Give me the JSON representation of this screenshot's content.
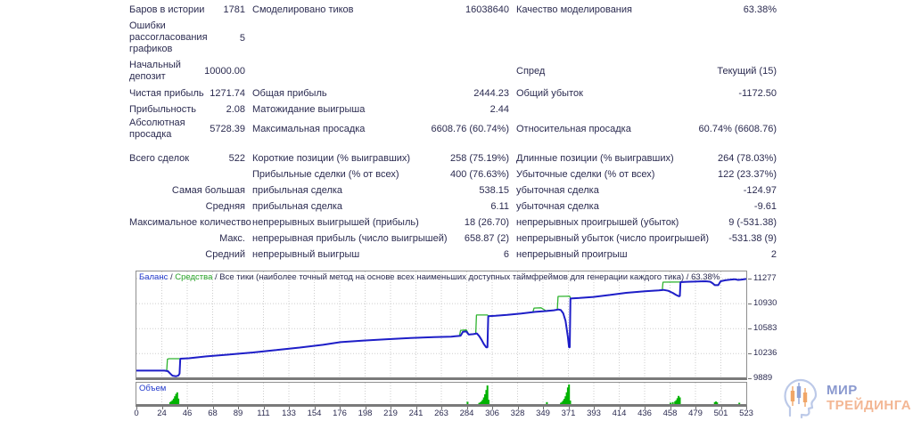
{
  "report": {
    "rows": [
      {
        "c1l": "Баров в истории",
        "c1v": "1781",
        "c2l": "Смоделировано тиков",
        "c2v": "16038640",
        "c3l": "Качество моделирования",
        "c3v": "63.38%"
      },
      {
        "c1l": "Ошибки рассогласования графиков",
        "c1v": "5",
        "c2l": "",
        "c2v": "",
        "c3l": "",
        "c3v": ""
      },
      {
        "c1l": "Начальный депозит",
        "c1v": "10000.00",
        "c2l": "",
        "c2v": "",
        "c3l": "Спред",
        "c3v": "Текущий (15)"
      },
      {
        "c1l": "Чистая прибыль",
        "c1v": "1271.74",
        "c2l": "Общая прибыль",
        "c2v": "2444.23",
        "c3l": "Общий убыток",
        "c3v": "-1172.50"
      },
      {
        "c1l": "Прибыльность",
        "c1v": "2.08",
        "c2l": "Матожидание выигрыша",
        "c2v": "2.44",
        "c3l": "",
        "c3v": ""
      },
      {
        "c1l": "Абсолютная просадка",
        "c1v": "5728.39",
        "c2l": "Максимальная просадка",
        "c2v": "6608.76 (60.74%)",
        "c3l": "Относительная просадка",
        "c3v": "60.74% (6608.76)"
      },
      {
        "c1l": "Всего сделок",
        "c1v": "522",
        "c2l": "Короткие позиции (% выигравших)",
        "c2v": "258 (75.19%)",
        "c3l": "Длинные позиции (% выигравших)",
        "c3v": "264 (78.03%)"
      },
      {
        "c1l": "",
        "c1v": "",
        "c2l": "Прибыльные сделки (% от всех)",
        "c2v": "400 (76.63%)",
        "c3l": "Убыточные сделки (% от всех)",
        "c3v": "122 (23.37%)"
      },
      {
        "c1l": "Самая большая",
        "c1v": "",
        "c2l": "прибыльная сделка",
        "c2v": "538.15",
        "c3l": "убыточная сделка",
        "c3v": "-124.97"
      },
      {
        "c1l": "Средняя",
        "c1v": "",
        "c2l": "прибыльная сделка",
        "c2v": "6.11",
        "c3l": "убыточная сделка",
        "c3v": "-9.61"
      },
      {
        "c1l": "Максимальное количество",
        "c1v": "",
        "c2l": "непрерывных выигрышей (прибыль)",
        "c2v": "18 (26.70)",
        "c3l": "непрерывных проигрышей (убыток)",
        "c3v": "9 (-531.38)"
      },
      {
        "c1l": "Макс.",
        "c1v": "",
        "c2l": "непрерывная прибыль (число выигрышей)",
        "c2v": "658.87 (2)",
        "c3l": "непрерывный убыток (число проигрышей)",
        "c3v": "-531.38 (9)"
      },
      {
        "c1l": "Средний",
        "c1v": "",
        "c2l": "непрерывный выигрыш",
        "c2v": "6",
        "c3l": "непрерывный проигрыш",
        "c3v": "2"
      }
    ]
  },
  "chart": {
    "legend": {
      "balance": "Баланс",
      "sep": " / ",
      "equity": "Средства",
      "rest": "Все тики (наиболее точный метод на основе всех наименьших доступных таймфреймов для генерации каждого тика) / 63.38%"
    },
    "volume_label": "Объем"
  },
  "chart_data": {
    "type": "line",
    "title": "Баланс / Средства / Все тики / 63.38%",
    "xlim": [
      0,
      523
    ],
    "ylim": [
      9889,
      11290
    ],
    "y_ticks": [
      11277,
      10930,
      10583,
      10236,
      9889
    ],
    "x_ticks": [
      0,
      24,
      46,
      68,
      89,
      111,
      133,
      154,
      176,
      198,
      219,
      241,
      263,
      284,
      306,
      328,
      349,
      371,
      393,
      414,
      436,
      458,
      479,
      501,
      523
    ],
    "grid": "dashed",
    "series": [
      {
        "name": "Средства",
        "color": "#2eb32e",
        "points": [
          [
            0,
            10000
          ],
          [
            24,
            10000
          ],
          [
            26,
            10002
          ],
          [
            26.6,
            10160
          ],
          [
            28,
            10166
          ],
          [
            37.6,
            10166
          ],
          [
            45,
            10172
          ],
          [
            60,
            10198
          ],
          [
            80,
            10224
          ],
          [
            100,
            10252
          ],
          [
            120,
            10285
          ],
          [
            140,
            10320
          ],
          [
            160,
            10358
          ],
          [
            175,
            10395
          ],
          [
            195,
            10418
          ],
          [
            215,
            10436
          ],
          [
            235,
            10452
          ],
          [
            255,
            10464
          ],
          [
            270,
            10472
          ],
          [
            277,
            10480
          ],
          [
            278,
            10560
          ],
          [
            283,
            10565
          ],
          [
            285,
            10502
          ],
          [
            289,
            10506
          ],
          [
            291,
            10512
          ],
          [
            291.6,
            10772
          ],
          [
            301,
            10772
          ],
          [
            301.7,
            10758
          ],
          [
            308,
            10762
          ],
          [
            318,
            10775
          ],
          [
            330,
            10792
          ],
          [
            340,
            10812
          ],
          [
            341,
            10868
          ],
          [
            347,
            10872
          ],
          [
            351,
            10832
          ],
          [
            358,
            10838
          ],
          [
            361,
            10846
          ],
          [
            361.6,
            11030
          ],
          [
            371.6,
            11032
          ],
          [
            372.2,
            11002
          ],
          [
            380,
            11008
          ],
          [
            392,
            11022
          ],
          [
            406,
            11050
          ],
          [
            420,
            11080
          ],
          [
            436,
            11100
          ],
          [
            448,
            11114
          ],
          [
            451,
            11118
          ],
          [
            451.6,
            11228
          ],
          [
            466,
            11230
          ],
          [
            472,
            11232
          ],
          [
            481,
            11238
          ],
          [
            488,
            11240
          ],
          [
            492,
            11234
          ],
          [
            494,
            11216
          ],
          [
            496,
            11190
          ],
          [
            499,
            11190
          ],
          [
            501,
            11240
          ],
          [
            505,
            11254
          ],
          [
            509,
            11262
          ],
          [
            513,
            11268
          ],
          [
            516,
            11258
          ],
          [
            519,
            11264
          ],
          [
            523,
            11272
          ]
        ]
      },
      {
        "name": "Баланс",
        "color": "#1e1ec8",
        "points": [
          [
            0,
            10000
          ],
          [
            24,
            10000
          ],
          [
            27,
            9993
          ],
          [
            29,
            9960
          ],
          [
            31,
            9930
          ],
          [
            34,
            9922
          ],
          [
            36,
            9932
          ],
          [
            37,
            9960
          ],
          [
            37.6,
            10165
          ],
          [
            45,
            10172
          ],
          [
            60,
            10198
          ],
          [
            80,
            10224
          ],
          [
            100,
            10252
          ],
          [
            120,
            10285
          ],
          [
            140,
            10320
          ],
          [
            160,
            10358
          ],
          [
            175,
            10395
          ],
          [
            195,
            10418
          ],
          [
            215,
            10436
          ],
          [
            235,
            10452
          ],
          [
            255,
            10464
          ],
          [
            270,
            10472
          ],
          [
            278,
            10483
          ],
          [
            280,
            10538
          ],
          [
            283,
            10543
          ],
          [
            285,
            10500
          ],
          [
            289,
            10506
          ],
          [
            292,
            10516
          ],
          [
            294,
            10478
          ],
          [
            296,
            10428
          ],
          [
            298,
            10368
          ],
          [
            300,
            10322
          ],
          [
            301,
            10322
          ],
          [
            301.7,
            10755
          ],
          [
            308,
            10762
          ],
          [
            318,
            10775
          ],
          [
            330,
            10792
          ],
          [
            342,
            10815
          ],
          [
            352,
            10828
          ],
          [
            358,
            10838
          ],
          [
            362,
            10848
          ],
          [
            364,
            10840
          ],
          [
            366,
            10795
          ],
          [
            368,
            10690
          ],
          [
            370,
            10470
          ],
          [
            371,
            10322
          ],
          [
            371.6,
            10322
          ],
          [
            372.2,
            11000
          ],
          [
            380,
            11008
          ],
          [
            392,
            11022
          ],
          [
            406,
            11050
          ],
          [
            420,
            11080
          ],
          [
            436,
            11100
          ],
          [
            448,
            11114
          ],
          [
            452,
            11120
          ],
          [
            456,
            11108
          ],
          [
            460,
            11078
          ],
          [
            463,
            11048
          ],
          [
            465,
            11034
          ],
          [
            466,
            11034
          ],
          [
            466.6,
            11228
          ],
          [
            472,
            11232
          ],
          [
            481,
            11238
          ],
          [
            488,
            11240
          ],
          [
            492,
            11234
          ],
          [
            494,
            11214
          ],
          [
            496,
            11186
          ],
          [
            499,
            11186
          ],
          [
            501,
            11240
          ],
          [
            505,
            11254
          ],
          [
            509,
            11262
          ],
          [
            513,
            11268
          ],
          [
            516,
            11258
          ],
          [
            519,
            11264
          ],
          [
            523,
            11272
          ]
        ]
      }
    ],
    "volume": {
      "name": "Объем",
      "color": "#00b200",
      "bars": [
        [
          29,
          0.1
        ],
        [
          30,
          0.14
        ],
        [
          31,
          0.2
        ],
        [
          32,
          0.28
        ],
        [
          33,
          0.4
        ],
        [
          34,
          0.52
        ],
        [
          35,
          0.6
        ],
        [
          36,
          0.28
        ],
        [
          284,
          0.12
        ],
        [
          294,
          0.06
        ],
        [
          295,
          0.09
        ],
        [
          296,
          0.14
        ],
        [
          297,
          0.22
        ],
        [
          298,
          0.34
        ],
        [
          299,
          0.5
        ],
        [
          300,
          0.72
        ],
        [
          301,
          0.95
        ],
        [
          302,
          0.22
        ],
        [
          352,
          0.1
        ],
        [
          364,
          0.07
        ],
        [
          365,
          0.11
        ],
        [
          366,
          0.18
        ],
        [
          367,
          0.27
        ],
        [
          368,
          0.4
        ],
        [
          369,
          0.6
        ],
        [
          370,
          0.85
        ],
        [
          371,
          1.0
        ],
        [
          372,
          0.18
        ],
        [
          458,
          0.07
        ],
        [
          460,
          0.1
        ],
        [
          462,
          0.14
        ],
        [
          463,
          0.2
        ],
        [
          464,
          0.3
        ],
        [
          465,
          0.42
        ],
        [
          466,
          0.34
        ],
        [
          496,
          0.1
        ],
        [
          497,
          0.13
        ],
        [
          498,
          0.09
        ],
        [
          517,
          0.07
        ]
      ]
    }
  },
  "watermark": {
    "line1": "МИР",
    "line2": "ТРЕЙДИНГА"
  },
  "colors": {
    "balance": "#1e1ec8",
    "equity": "#2eb32e",
    "volume": "#00b200",
    "grid": "#cdcdcd",
    "text": "#2b2b50",
    "legend_blue": "#2038cc",
    "legend_green": "#28a428"
  }
}
